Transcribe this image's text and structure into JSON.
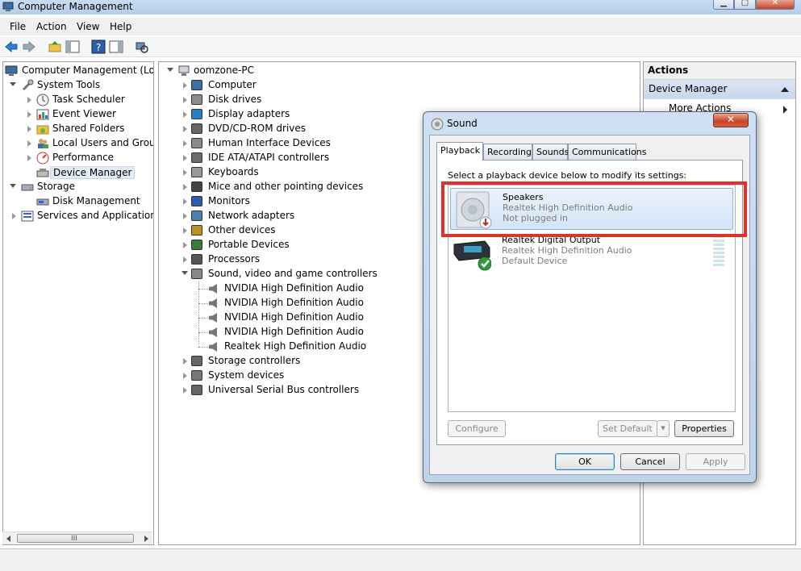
{
  "window": {
    "title": "Computer Management"
  },
  "menu": [
    "File",
    "Action",
    "View",
    "Help"
  ],
  "left_tree": {
    "root": "Computer Management (Local",
    "system_tools": "System Tools",
    "system_tools_children": [
      "Task Scheduler",
      "Event Viewer",
      "Shared Folders",
      "Local Users and Groups",
      "Performance",
      "Device Manager"
    ],
    "storage": "Storage",
    "storage_children": [
      "Disk Management"
    ],
    "services": "Services and Applications"
  },
  "device_tree": {
    "root": "oomzone-PC",
    "categories": [
      "Computer",
      "Disk drives",
      "Display adapters",
      "DVD/CD-ROM drives",
      "Human Interface Devices",
      "IDE ATA/ATAPI controllers",
      "Keyboards",
      "Mice and other pointing devices",
      "Monitors",
      "Network adapters",
      "Other devices",
      "Portable Devices",
      "Processors",
      "Sound, video and game controllers"
    ],
    "sound_children": [
      "NVIDIA High Definition Audio",
      "NVIDIA High Definition Audio",
      "NVIDIA High Definition Audio",
      "NVIDIA High Definition Audio",
      "Realtek High Definition Audio"
    ],
    "tail_categories": [
      "Storage controllers",
      "System devices",
      "Universal Serial Bus controllers"
    ]
  },
  "actions": {
    "header": "Actions",
    "group": "Device Manager",
    "more": "More Actions"
  },
  "dialog": {
    "title": "Sound",
    "close": "✕",
    "tabs": [
      "Playback",
      "Recording",
      "Sounds",
      "Communications"
    ],
    "instruction": "Select a playback device below to modify its settings:",
    "devices": [
      {
        "name": "Speakers",
        "description": "Realtek High Definition Audio",
        "status": "Not plugged in"
      },
      {
        "name": "Realtek Digital Output",
        "description": "Realtek High Definition Audio",
        "status": "Default Device"
      }
    ],
    "buttons": {
      "configure": "Configure",
      "set_default": "Set Default",
      "properties": "Properties",
      "ok": "OK",
      "cancel": "Cancel",
      "apply": "Apply"
    }
  },
  "scrollbar": {
    "grip": "III"
  },
  "colors": {
    "highlight_box": "#e0322d",
    "selection": "#d4e5f7",
    "title_bar": "#c9dcf1"
  }
}
